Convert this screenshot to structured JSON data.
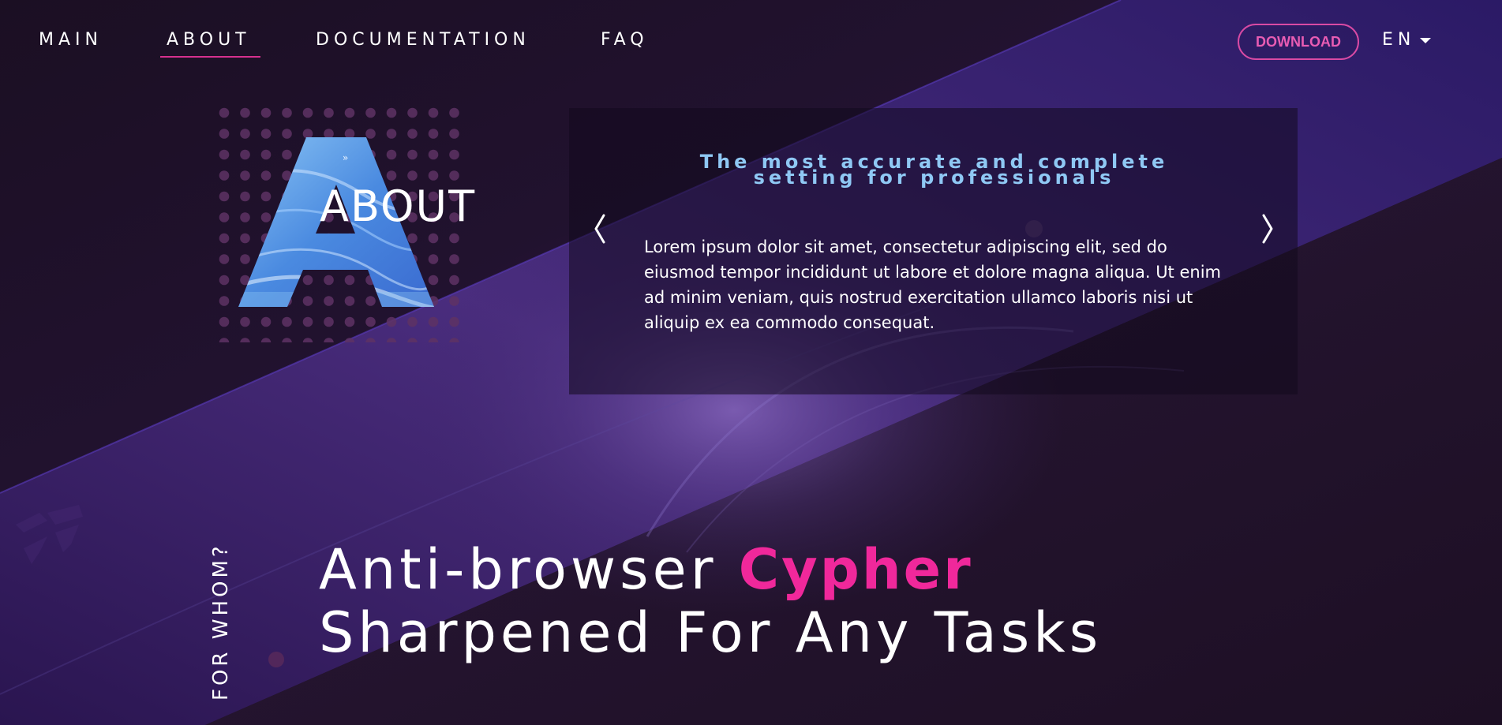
{
  "nav": {
    "items": [
      {
        "label": "MAIN"
      },
      {
        "label": "ABOUT"
      },
      {
        "label": "DOCUMENTATION"
      },
      {
        "label": "FAQ"
      }
    ],
    "download_label": "DOWNLOAD",
    "language": "EN"
  },
  "about": {
    "word": "ABOUT"
  },
  "slider": {
    "title": "The most accurate and complete setting for professionals",
    "text": "Lorem ipsum dolor sit amet, consectetur adipiscing elit, sed do eiusmod tempor incididunt ut labore et dolore magna aliqua. Ut enim ad minim veniam, quis nostrud exercitation ullamco laboris nisi ut aliquip ex ea commodo consequat."
  },
  "section": {
    "vertical_label": "FOR WHOM?",
    "headline_line1_prefix": "Anti-browser ",
    "headline_line1_accent": "Cypher",
    "headline_line2": "Sharpened For Any Tasks"
  },
  "colors": {
    "accent": "#f0289b",
    "title_blue": "#8fc8f4",
    "download_pink": "#e85cb3"
  }
}
